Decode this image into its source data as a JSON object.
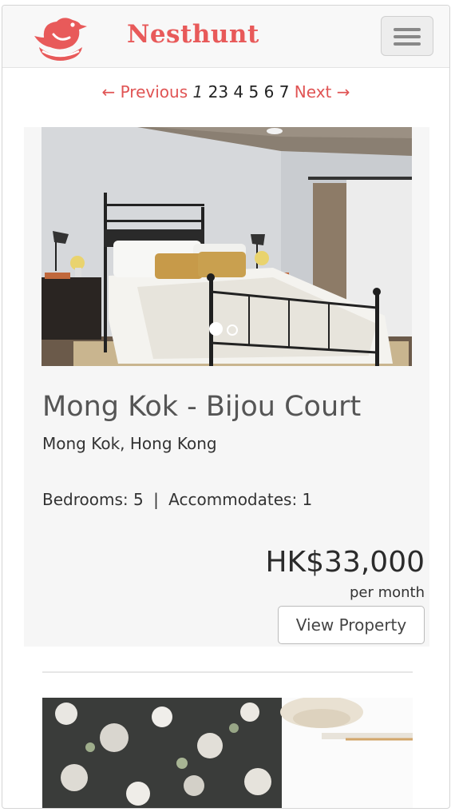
{
  "brand": {
    "name": "Nesthunt"
  },
  "colors": {
    "accent": "#e85a5a"
  },
  "pagination": {
    "previous_label": "← Previous",
    "current_page": "1",
    "pages": [
      "2",
      "3",
      "4",
      "5",
      "6",
      "7"
    ],
    "next_label": "Next →"
  },
  "listing": {
    "title": "Mong Kok - Bijou Court",
    "location": "Mong Kok, Hong Kong",
    "bedrooms_label": "Bedrooms: 5",
    "separator": "|",
    "accommodates_label": "Accommodates: 1",
    "price": "HK$33,000",
    "period": "per month",
    "view_label": "View Property"
  },
  "icons": {
    "logo": "bird-nest-logo",
    "menu": "hamburger-icon"
  }
}
